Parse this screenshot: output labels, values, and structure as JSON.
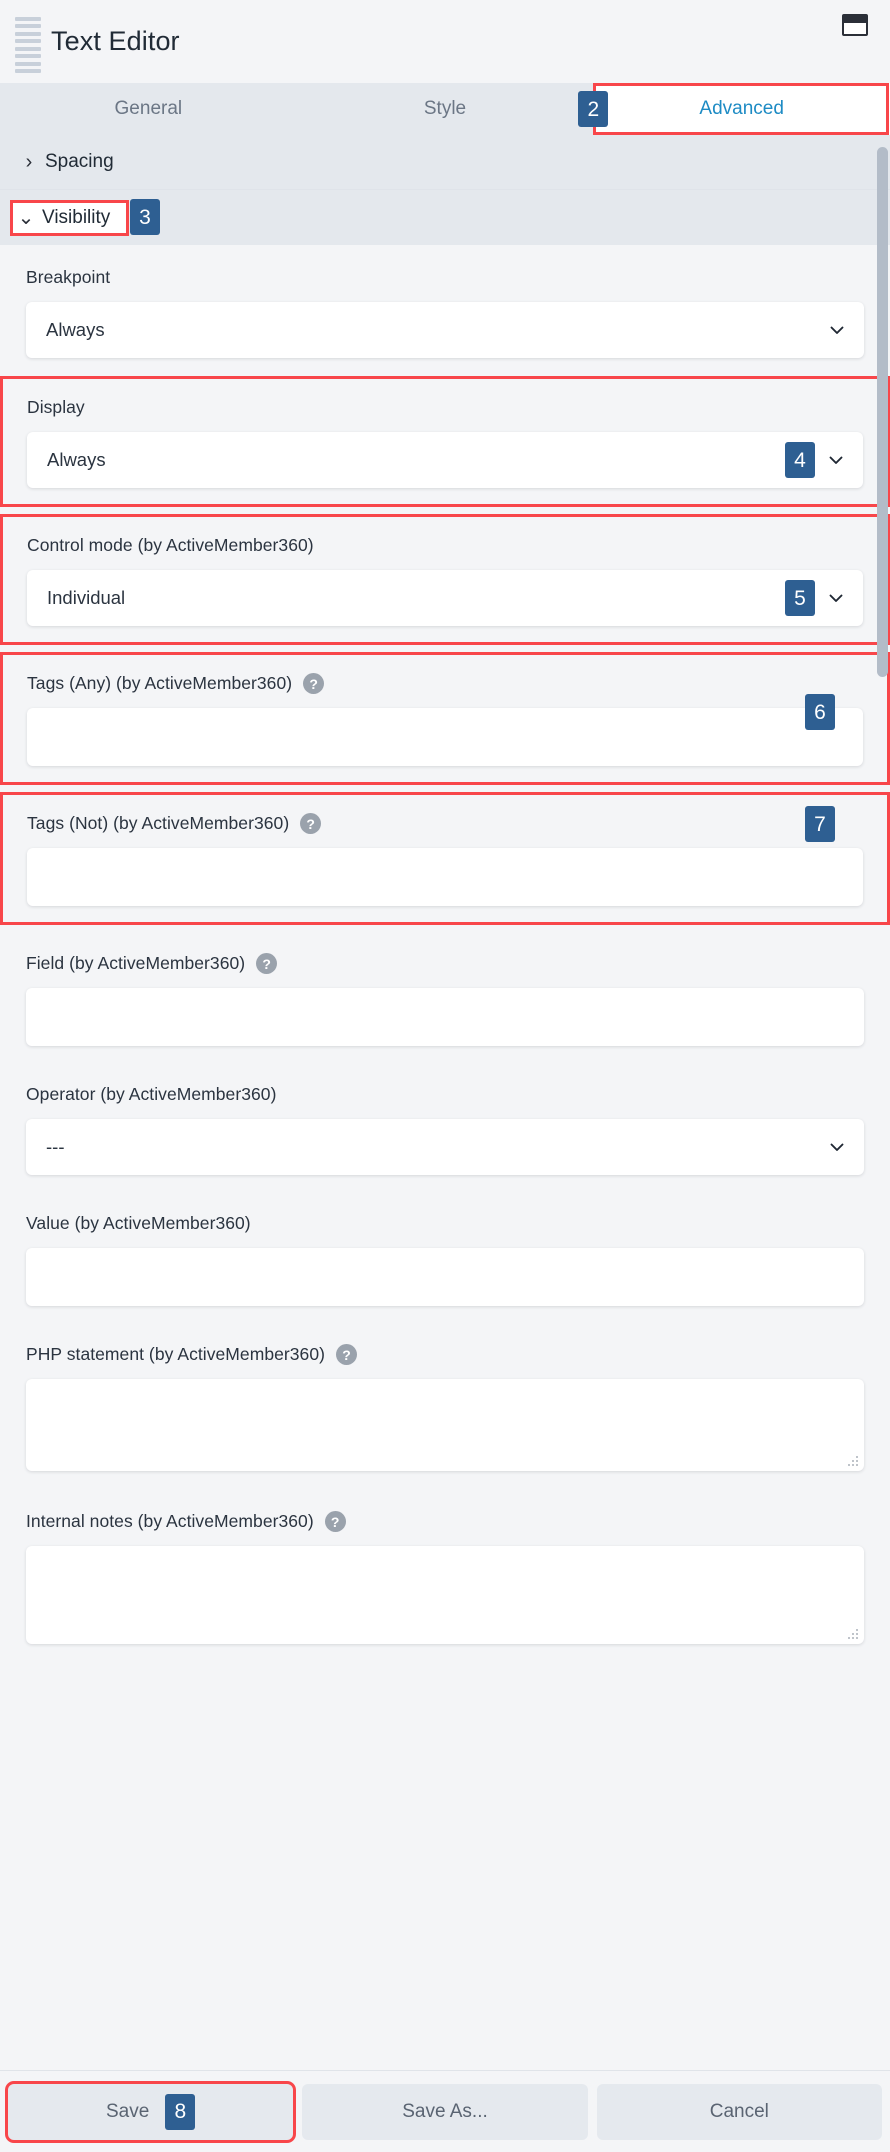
{
  "header": {
    "title": "Text Editor",
    "drag_handle_icon": "drag-handle-icon",
    "window_icon": "window-layout-icon"
  },
  "tabs": [
    {
      "label": "General",
      "active": false
    },
    {
      "label": "Style",
      "active": false,
      "badge": "2"
    },
    {
      "label": "Advanced",
      "active": true,
      "highlighted": true
    }
  ],
  "sections": [
    {
      "label": "Spacing",
      "expanded": false,
      "chevron": "chevron-right-icon"
    },
    {
      "label": "Visibility",
      "expanded": true,
      "chevron": "chevron-down-icon",
      "badge": "3",
      "highlighted": true
    }
  ],
  "fields": {
    "breakpoint": {
      "label": "Breakpoint",
      "value": "Always",
      "type": "select"
    },
    "display": {
      "label": "Display",
      "value": "Always",
      "type": "select",
      "badge": "4",
      "highlighted": true
    },
    "control_mode": {
      "label": "Control mode (by ActiveMember360)",
      "value": "Individual",
      "type": "select",
      "badge": "5",
      "highlighted": true
    },
    "tags_any": {
      "label": "Tags (Any) (by ActiveMember360)",
      "value": "",
      "type": "input",
      "help": "?",
      "badge": "6",
      "highlighted": true
    },
    "tags_not": {
      "label": "Tags (Not) (by ActiveMember360)",
      "value": "",
      "type": "input",
      "help": "?",
      "badge": "7",
      "highlighted": true
    },
    "field": {
      "label": "Field (by ActiveMember360)",
      "value": "",
      "type": "input",
      "help": "?"
    },
    "operator": {
      "label": "Operator (by ActiveMember360)",
      "value": "---",
      "type": "select"
    },
    "value": {
      "label": "Value (by ActiveMember360)",
      "value": "",
      "type": "input"
    },
    "php_statement": {
      "label": "PHP statement (by ActiveMember360)",
      "value": "",
      "type": "textarea",
      "help": "?"
    },
    "internal_notes": {
      "label": "Internal notes (by ActiveMember360)",
      "value": "",
      "type": "textarea",
      "help": "?"
    }
  },
  "footer": {
    "save": "Save",
    "save_badge": "8",
    "save_as": "Save As...",
    "cancel": "Cancel"
  },
  "colors": {
    "accent_blue": "#1d8bc4",
    "badge_blue": "#2e5f92",
    "highlight_red": "#f8464a",
    "panel_bg": "#f4f5f7",
    "tab_bg": "#e4e8ed"
  }
}
